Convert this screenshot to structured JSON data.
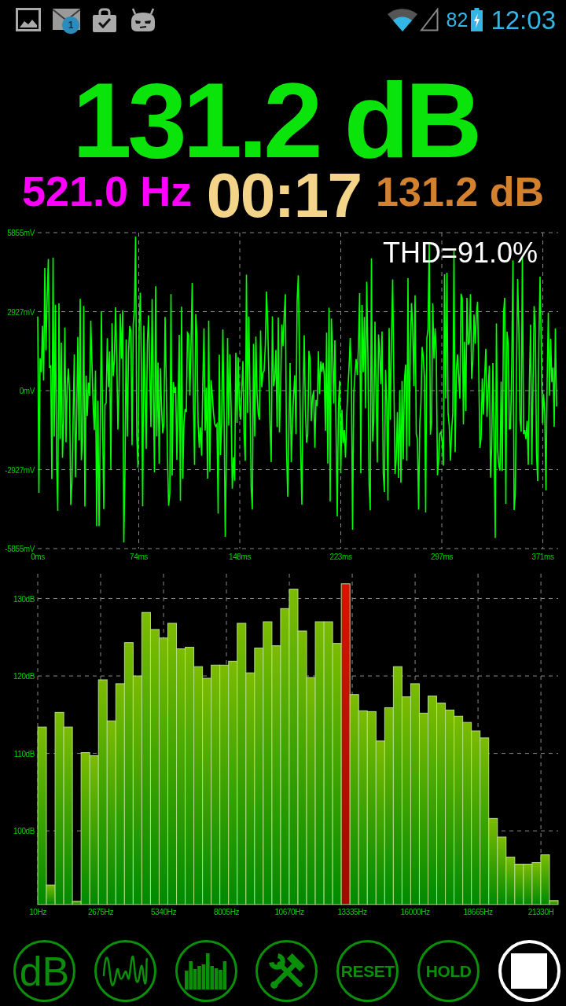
{
  "status_bar": {
    "notification_count": "1",
    "battery_percent": "82",
    "time": "12:03"
  },
  "reading": {
    "sound_level": "131.2 dB",
    "frequency": "521.0 Hz",
    "timer": "00:17",
    "secondary_level": "131.2 dB"
  },
  "oscilloscope": {
    "thd": "THD=91.0%",
    "y_labels": [
      "5855mV",
      "2927mV",
      "0mV",
      "-2927mV",
      "-5855mV"
    ],
    "x_labels": [
      "0ms",
      "74ms",
      "148ms",
      "223ms",
      "297ms",
      "371ms"
    ]
  },
  "spectrum": {
    "chart_data": {
      "type": "bar",
      "grid": true,
      "x": [
        194,
        561,
        929,
        1296,
        1664,
        2031,
        2399,
        2766,
        3134,
        3501,
        3869,
        4236,
        4604,
        4971,
        5339,
        5706,
        6074,
        6441,
        6809,
        7176,
        7544,
        7911,
        8279,
        8646,
        9014,
        9381,
        9749,
        10116,
        10484,
        10851,
        11219,
        11586,
        11954,
        12321,
        12689,
        13056,
        13424,
        13791,
        14159,
        14526,
        14894,
        15261,
        15629,
        15996,
        16364,
        16731,
        17099,
        17466,
        17834,
        18201,
        18569,
        18936,
        19304,
        19671,
        20039,
        20406,
        20774,
        21141,
        21509,
        21876
      ],
      "xlim": [
        10,
        22060
      ],
      "ylim": [
        90.5,
        133.2
      ],
      "xticks": [
        {
          "value": 10,
          "label": "10Hz"
        },
        {
          "value": 2675,
          "label": "2675Hz"
        },
        {
          "value": 5340,
          "label": "5340Hz"
        },
        {
          "value": 8005,
          "label": "8005Hz"
        },
        {
          "value": 10670,
          "label": "10670Hz"
        },
        {
          "value": 13335,
          "label": "13335Hz"
        },
        {
          "value": 16000,
          "label": "16000Hz"
        },
        {
          "value": 18665,
          "label": "18665Hz"
        },
        {
          "value": 21330,
          "label": "21330H"
        }
      ],
      "yticks": [
        {
          "value": 100,
          "label": "100dB"
        },
        {
          "value": 110,
          "label": "110dB"
        },
        {
          "value": 120,
          "label": "120dB"
        },
        {
          "value": 130,
          "label": "130dB"
        }
      ],
      "series": [
        {
          "color": "#b4dc8c",
          "values": [
            113.4,
            93.0,
            115.3,
            113.4,
            90.9,
            110.1,
            109.7,
            119.5,
            114.2,
            119.0,
            124.3,
            120.0,
            128.2,
            126.0,
            124.9,
            126.8,
            123.5,
            123.7,
            121.2,
            119.7,
            121.4,
            121.4,
            121.9,
            126.8,
            120.4,
            123.6,
            127.0,
            123.9,
            128.7,
            131.2,
            125.8,
            119.8,
            127.0,
            127.0,
            124.2,
            131.9,
            117.6,
            115.5,
            115.4,
            111.6,
            115.9,
            121.2,
            117.3,
            119.0,
            115.2,
            117.4,
            116.5,
            115.6,
            114.8,
            114.0,
            112.9,
            112.0,
            101.6,
            99.2,
            96.6,
            95.7,
            95.7,
            95.9,
            96.9,
            91.0
          ]
        }
      ]
    }
  },
  "buttons": [
    {
      "kind": "unit",
      "label": "dB"
    },
    {
      "kind": "waveform"
    },
    {
      "kind": "spectrum"
    },
    {
      "kind": "tools"
    },
    {
      "kind": "text",
      "label": "RESET"
    },
    {
      "kind": "text",
      "label": "HOLD"
    },
    {
      "kind": "stop"
    }
  ]
}
